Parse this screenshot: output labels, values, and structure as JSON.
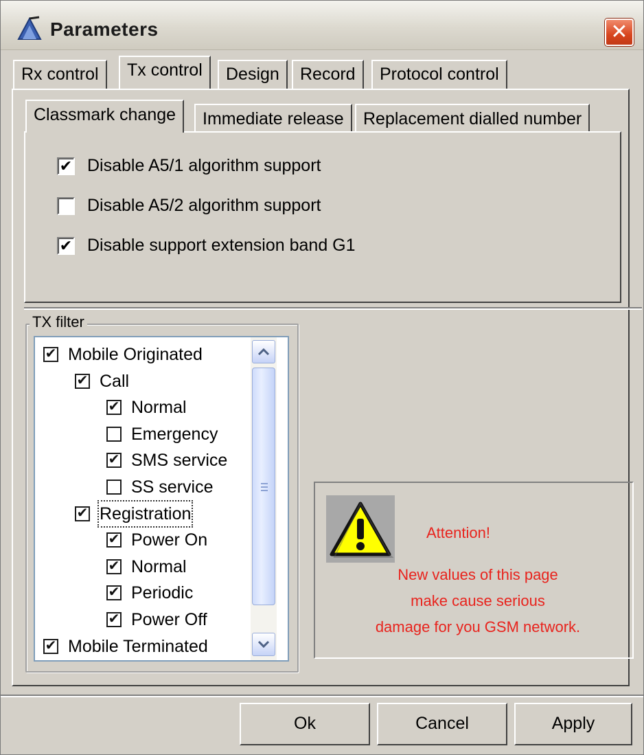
{
  "window": {
    "title": "Parameters"
  },
  "tabs": [
    {
      "label": "Rx control"
    },
    {
      "label": "Tx control",
      "active": true
    },
    {
      "label": "Design"
    },
    {
      "label": "Record"
    },
    {
      "label": "Protocol control"
    }
  ],
  "subtabs": [
    {
      "label": "Classmark change",
      "active": true
    },
    {
      "label": "Immediate release"
    },
    {
      "label": "Replacement dialled number"
    }
  ],
  "options": [
    {
      "label": "Disable A5/1 algorithm support",
      "checked": true
    },
    {
      "label": "Disable A5/2 algorithm support",
      "checked": false
    },
    {
      "label": "Disable support extension band G1",
      "checked": true
    }
  ],
  "tx_filter": {
    "legend": "TX filter",
    "items": [
      {
        "label": "Mobile Originated",
        "checked": true,
        "level": 0
      },
      {
        "label": "Call",
        "checked": true,
        "level": 1
      },
      {
        "label": "Normal",
        "checked": true,
        "level": 2
      },
      {
        "label": "Emergency",
        "checked": false,
        "level": 2
      },
      {
        "label": "SMS service",
        "checked": true,
        "level": 2
      },
      {
        "label": "SS service",
        "checked": false,
        "level": 2
      },
      {
        "label": "Registration",
        "checked": true,
        "level": 1,
        "focused": true
      },
      {
        "label": "Power On",
        "checked": true,
        "level": 2
      },
      {
        "label": "Normal",
        "checked": true,
        "level": 2
      },
      {
        "label": "Periodic",
        "checked": true,
        "level": 2
      },
      {
        "label": "Power Off",
        "checked": true,
        "level": 2
      },
      {
        "label": "Mobile Terminated",
        "checked": true,
        "level": 0
      }
    ]
  },
  "warning": {
    "title": "Attention!",
    "lines": [
      "New values of this page",
      "make cause serious",
      "damage for you GSM network."
    ],
    "color": "#e8231d"
  },
  "buttons": {
    "ok": "Ok",
    "cancel": "Cancel",
    "apply": "Apply"
  },
  "icons": {
    "app": "antenna-icon",
    "close": "close-icon",
    "warning": "warning-icon",
    "check": "✔",
    "scroll_up": "chevron-up-icon",
    "scroll_down": "chevron-down-icon"
  }
}
